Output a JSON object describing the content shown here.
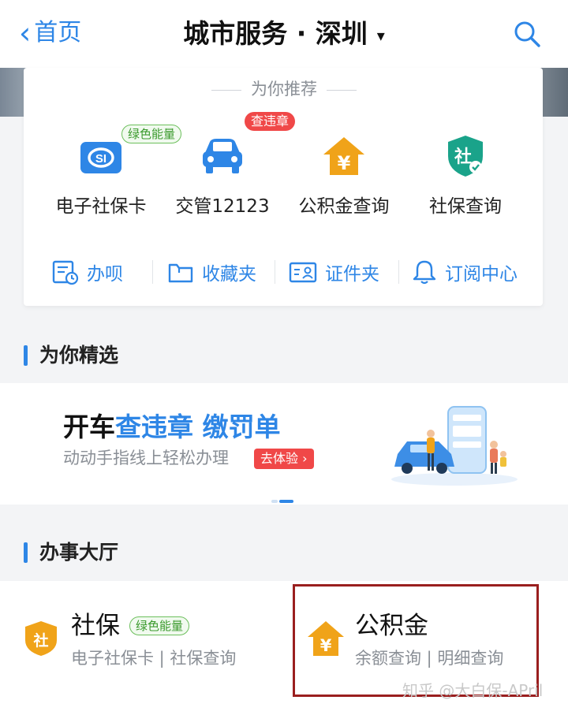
{
  "header": {
    "back_label": "首页",
    "title": "城市服务 · 深圳",
    "caret": "▾"
  },
  "recommend": {
    "title": "为你推荐",
    "services": [
      {
        "label": "电子社保卡",
        "icon": "social-security-card-icon",
        "tag": "绿色能量"
      },
      {
        "label": "交管12123",
        "icon": "car-icon",
        "tag": "查违章"
      },
      {
        "label": "公积金查询",
        "icon": "housing-fund-icon"
      },
      {
        "label": "社保查询",
        "icon": "social-insurance-shield-icon"
      }
    ],
    "quick": [
      {
        "label": "办呗",
        "icon": "todo-list-icon"
      },
      {
        "label": "收藏夹",
        "icon": "folder-icon"
      },
      {
        "label": "证件夹",
        "icon": "id-card-icon"
      },
      {
        "label": "订阅中心",
        "icon": "bell-icon"
      }
    ]
  },
  "featured": {
    "title": "为你精选",
    "headline_part1": "开车",
    "headline_part2": "查违章 缴罚单",
    "subtitle": "动动手指线上轻松办理",
    "cta": "去体验 ›"
  },
  "hall": {
    "title": "办事大厅",
    "items": [
      {
        "name": "社保",
        "tag": "绿色能量",
        "sub": "电子社保卡 | 社保查询",
        "icon": "social-insurance-shield-icon"
      },
      {
        "name": "公积金",
        "sub": "余额查询 | 明细查询",
        "icon": "housing-fund-icon"
      }
    ]
  },
  "watermark": "知乎 @大白保-APril",
  "colors": {
    "accent": "#2e86e6",
    "orange": "#f0a319",
    "green_tag": "#3b9a2d",
    "red_tag": "#f04848",
    "highlight_box": "#9a1f1f"
  }
}
